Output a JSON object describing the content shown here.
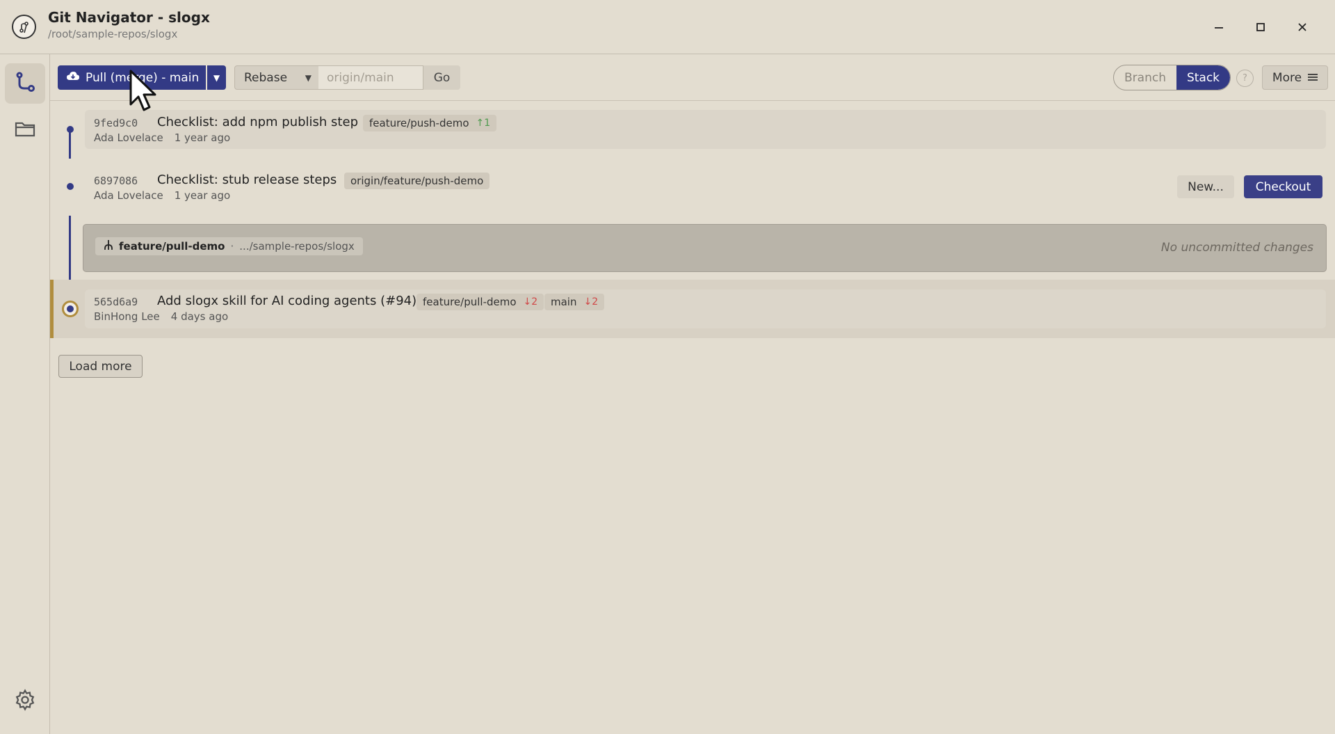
{
  "window": {
    "title": "Git Navigator - slogx",
    "path": "/root/sample-repos/slogx"
  },
  "toolbar": {
    "pull_label": "Pull (merge) - main",
    "mode_value": "Rebase",
    "target_placeholder": "origin/main",
    "go_label": "Go",
    "view_branch": "Branch",
    "view_stack": "Stack",
    "help_label": "?",
    "more_label": "More"
  },
  "commits": [
    {
      "hash": "9fed9c0",
      "message": "Checklist: add npm publish step",
      "author": "Ada Lovelace",
      "time": "1 year ago",
      "tags": [
        {
          "name": "feature/push-demo",
          "ahead": "↑1"
        }
      ]
    },
    {
      "hash": "6897086",
      "message": "Checklist: stub release steps",
      "author": "Ada Lovelace",
      "time": "1 year ago",
      "tags": [
        {
          "name": "origin/feature/push-demo"
        }
      ],
      "actions": {
        "new_label": "New...",
        "checkout_label": "Checkout"
      }
    },
    {
      "hash": "565d6a9",
      "message": "Add slogx skill for AI coding agents (#94)",
      "author": "BinHong Lee",
      "time": "4 days ago",
      "tags": [
        {
          "name": "feature/pull-demo",
          "behind": "↓2"
        },
        {
          "name": "main",
          "behind": "↓2"
        }
      ]
    }
  ],
  "worktree": {
    "branch": "feature/pull-demo",
    "separator": "·",
    "path": ".../sample-repos/slogx",
    "status": "No uncommitted changes"
  },
  "load_more_label": "Load more",
  "colors": {
    "accent": "#333a85",
    "head": "#b08d3e",
    "background": "#e3ddd0"
  }
}
